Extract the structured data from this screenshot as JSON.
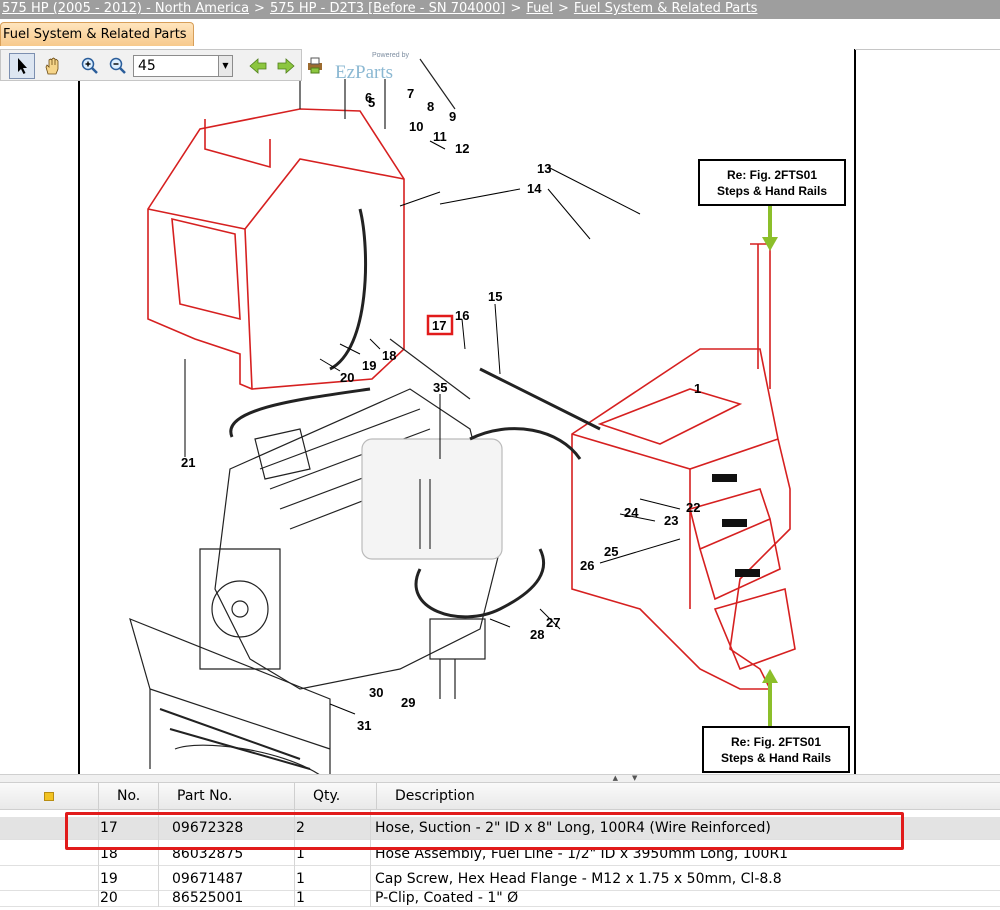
{
  "breadcrumb": {
    "items": [
      "575 HP (2005 - 2012) - North America",
      "575 HP - D2T3 [Before - SN 704000]",
      "Fuel",
      "Fuel System & Related Parts"
    ],
    "separator": ">"
  },
  "tab": {
    "label": "Fuel System & Related Parts"
  },
  "toolbar": {
    "zoom_value": "45",
    "tools": [
      "select-pointer-icon",
      "hand-pan-icon",
      "zoom-in-icon",
      "zoom-out-icon",
      "arrow-left-icon",
      "arrow-right-icon",
      "print-icon"
    ]
  },
  "watermark": {
    "text": "EzParts",
    "sub": "Powered by"
  },
  "diagram": {
    "callouts": [
      {
        "line1": "Re: Fig. 2FTS01",
        "line2": "Steps & Hand Rails"
      },
      {
        "line1": "Re: Fig. 2FTS01",
        "line2": "Steps & Hand Rails"
      }
    ],
    "highlighted_ref": "17",
    "ref_numbers": [
      "5",
      "6",
      "7",
      "8",
      "9",
      "10",
      "11",
      "12",
      "13",
      "14",
      "15",
      "16",
      "17",
      "18",
      "19",
      "20",
      "21",
      "22",
      "23",
      "24",
      "25",
      "26",
      "27",
      "28",
      "29",
      "30",
      "31",
      "35",
      "1"
    ]
  },
  "grid": {
    "columns": [
      "No.",
      "Part No.",
      "Qty.",
      "Description"
    ],
    "rows": [
      {
        "no": "17",
        "part": "09672328",
        "qty": "2",
        "desc": "Hose, Suction - 2\" ID x 8\" Long, 100R4 (Wire Reinforced)",
        "selected": true
      },
      {
        "no": "18",
        "part": "86032875",
        "qty": "1",
        "desc": "Hose Assembly, Fuel Line - 1/2\" ID x 3950mm Long, 100R1",
        "selected": false
      },
      {
        "no": "19",
        "part": "09671487",
        "qty": "1",
        "desc": "Cap Screw, Hex Head Flange - M12 x 1.75 x 50mm, Cl-8.8",
        "selected": false
      },
      {
        "no": "20",
        "part": "86525001",
        "qty": "1",
        "desc": "P-Clip, Coated - 1\" Ø",
        "selected": false
      }
    ]
  },
  "colors": {
    "highlight": "#e11b1b",
    "diagram_red": "#d62020",
    "callout_arrow": "#8cbf2a"
  }
}
